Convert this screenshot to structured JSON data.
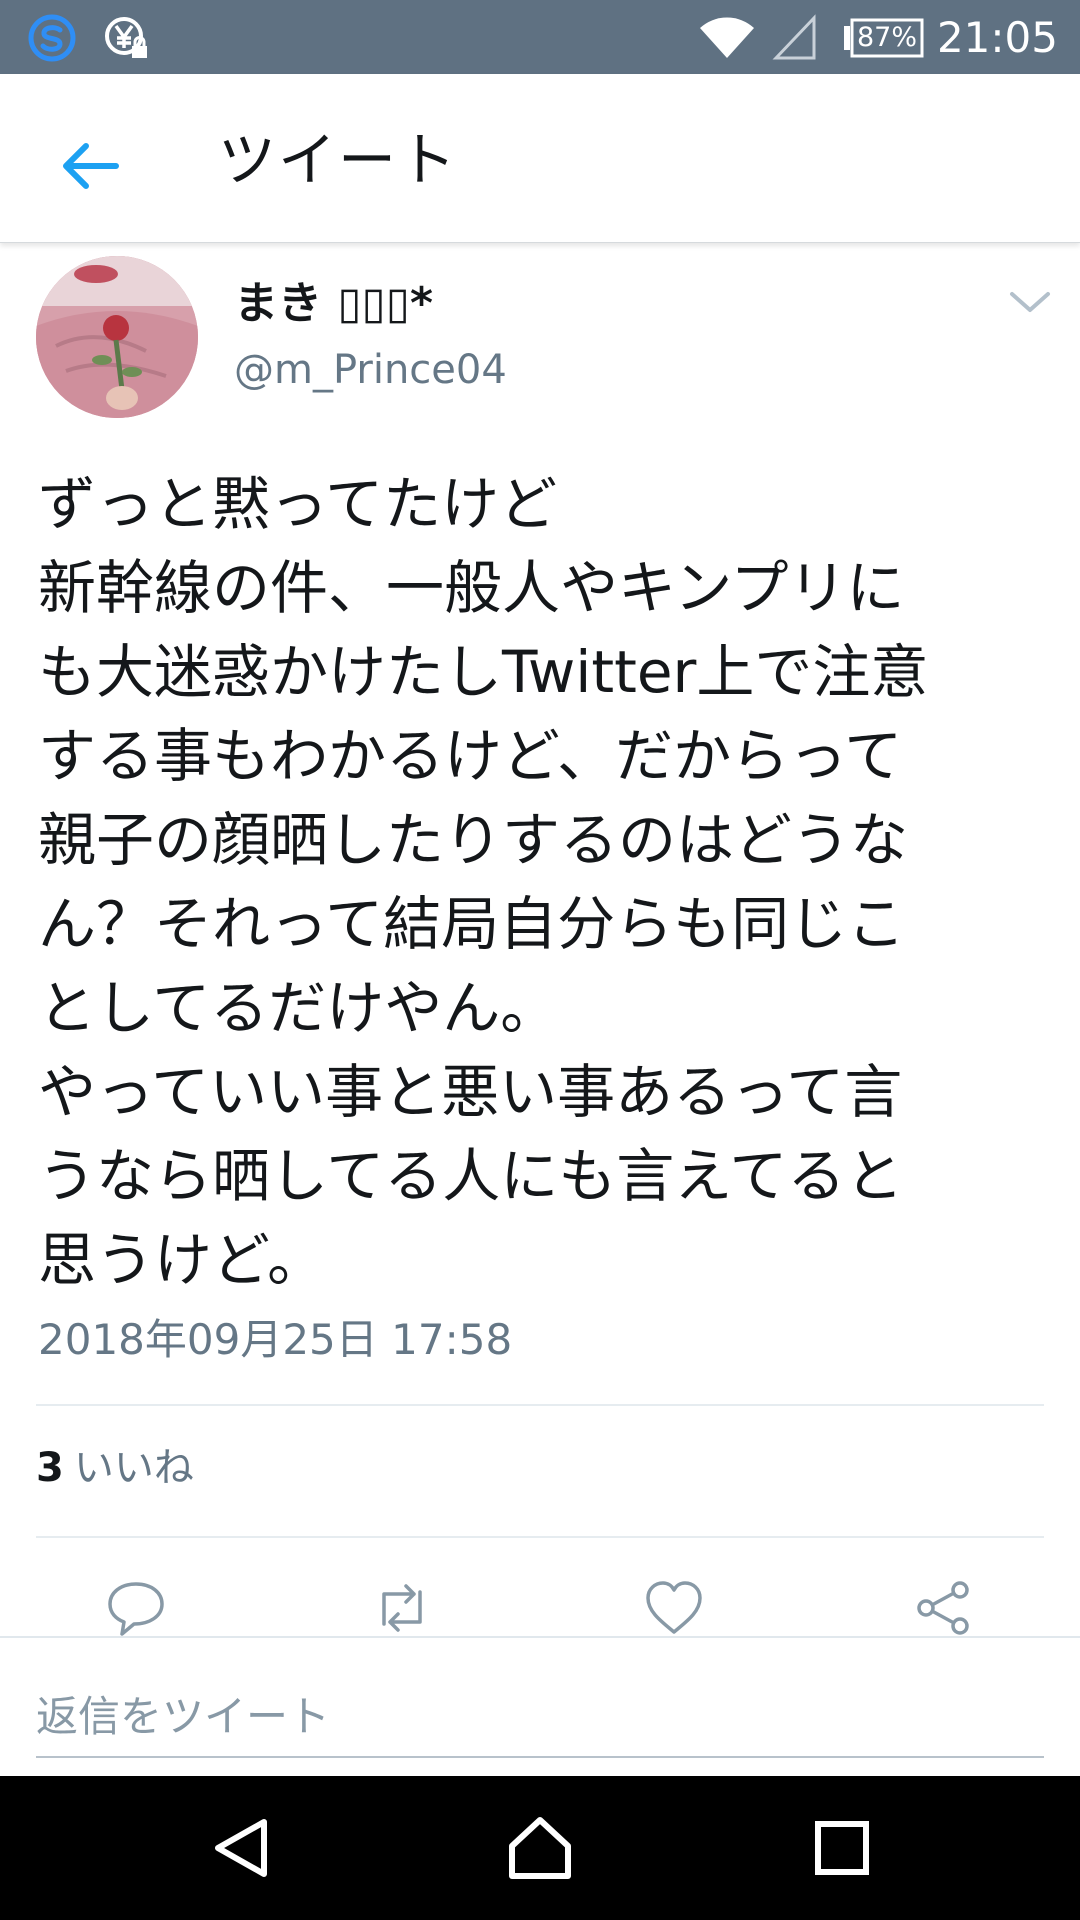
{
  "status_bar": {
    "battery": "87%",
    "time": "21:05",
    "icons": [
      "s-app-icon",
      "yen-lock-icon",
      "wifi-icon",
      "signal-icon",
      "battery-icon"
    ]
  },
  "app_bar": {
    "title": "ツイート",
    "back_icon": "arrow-left-icon"
  },
  "tweet": {
    "display_name": "まき ▯▯▯*",
    "handle": "@m_Prince04",
    "lines": [
      "ずっと黙ってたけど",
      "新幹線の件、一般人やキンプリに",
      "も大迷惑かけたしTwitter上で注意",
      "する事もわかるけど、だからって",
      "親子の顔晒したりするのはどうな",
      "ん？それって結局自分らも同じこ",
      "としてるだけやん。",
      "やっていい事と悪い事あるって言",
      "うなら晒してる人にも言えてると",
      "思うけど。"
    ],
    "timestamp": "2018年09月25日 17:58",
    "likes_count": "3",
    "likes_label": "いいね"
  },
  "actions": [
    "reply-icon",
    "retweet-icon",
    "like-icon",
    "share-icon"
  ],
  "reply": {
    "placeholder": "返信をツイート"
  },
  "nav": [
    "back-triangle-icon",
    "home-icon",
    "recents-icon"
  ],
  "colors": {
    "status_bar": "#5f7182",
    "accent_blue": "#1da1f2",
    "secondary_text": "#657786",
    "icon_gray": "#8899a6"
  }
}
